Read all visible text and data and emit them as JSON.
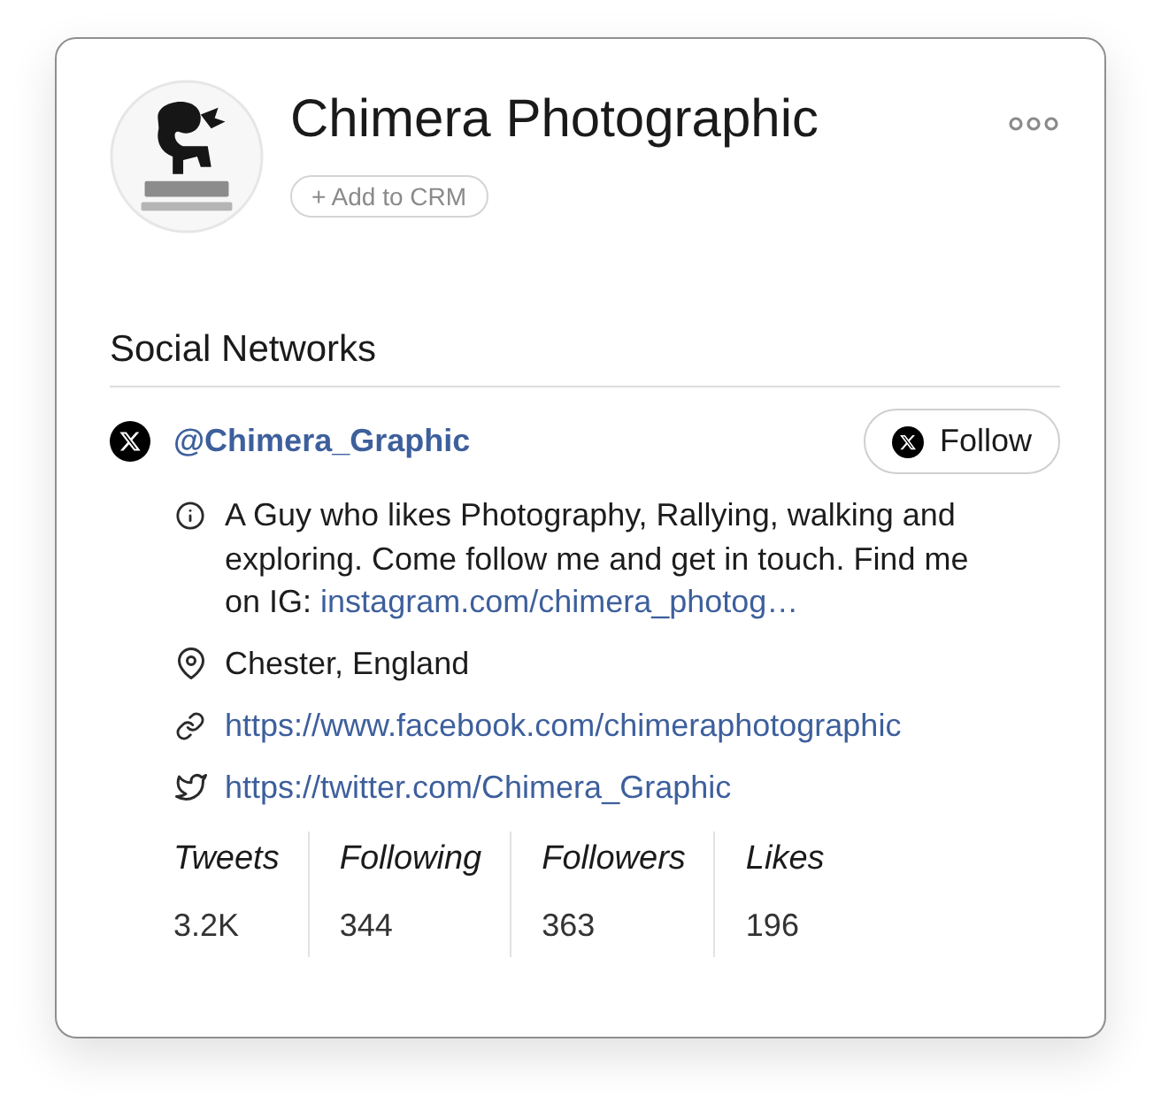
{
  "header": {
    "name": "Chimera Photographic",
    "add_button": "+ Add to CRM"
  },
  "section": {
    "title": "Social Networks"
  },
  "account": {
    "handle": "@Chimera_Graphic",
    "follow_button": "Follow",
    "bio": "A Guy who likes Photography, Rallying, walking and exploring. Come follow me and get in touch. Find me on IG:",
    "bio_link": "instagram.com/chimera_photog…",
    "details": [
      {
        "kind": "location",
        "text": "Chester, England"
      },
      {
        "kind": "link",
        "text": "https://www.facebook.com/chimeraphotographic"
      },
      {
        "kind": "twitter",
        "text": "https://twitter.com/Chimera_Graphic"
      }
    ],
    "stats": [
      {
        "label": "Tweets",
        "value": "3.2K"
      },
      {
        "label": "Following",
        "value": "344"
      },
      {
        "label": "Followers",
        "value": "363"
      },
      {
        "label": "Likes",
        "value": "196"
      }
    ]
  }
}
